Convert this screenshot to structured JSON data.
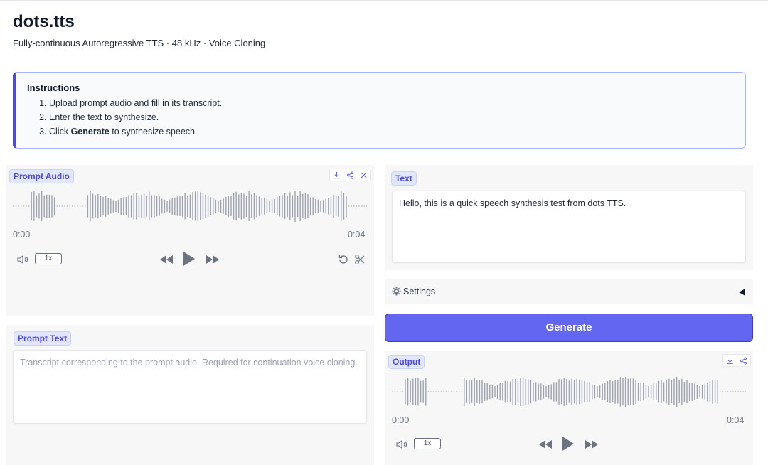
{
  "app": {
    "title": "dots.tts",
    "subtitle": "Fully-continuous Autoregressive TTS · 48 kHz · Voice Cloning"
  },
  "instructions": {
    "heading": "Instructions",
    "step1": "Upload prompt audio and fill in its transcript.",
    "step2": "Enter the text to synthesize.",
    "step3_prefix": "Click ",
    "step3_bold": "Generate",
    "step3_suffix": " to synthesize speech."
  },
  "prompt_audio": {
    "label": "Prompt Audio",
    "time_start": "0:00",
    "time_end": "0:04",
    "speed": "1x"
  },
  "prompt_text": {
    "label": "Prompt Text",
    "value": "",
    "placeholder": "Transcript corresponding to the prompt audio. Required for continuation voice cloning."
  },
  "text_input": {
    "label": "Text",
    "value": "Hello, this is a quick speech synthesis test from dots TTS."
  },
  "settings": {
    "label": "Settings",
    "icon": "gear-icon",
    "toggle_icon": "triangle-left-icon"
  },
  "generate": {
    "label": "Generate"
  },
  "output": {
    "label": "Output",
    "time_start": "0:00",
    "time_end": "0:04",
    "speed": "1x"
  },
  "colors": {
    "accent": "#6366f1",
    "badge_text": "#4f46e5",
    "badge_bg": "#e0e7ff",
    "waveform": "#9ca3af"
  }
}
